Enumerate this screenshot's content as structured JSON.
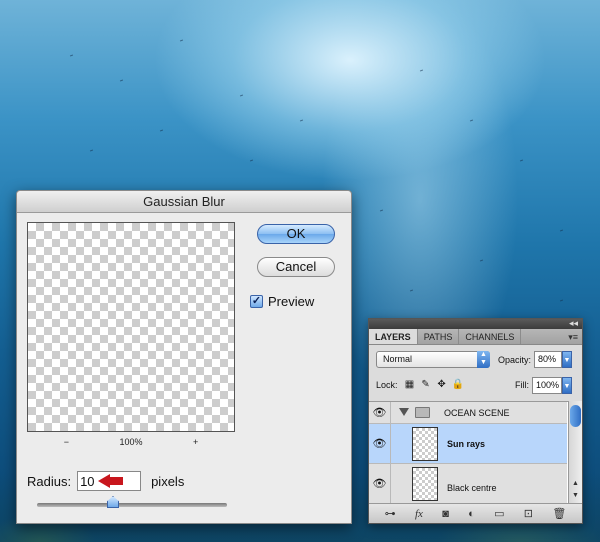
{
  "gaussian_blur": {
    "title": "Gaussian Blur",
    "ok_label": "OK",
    "cancel_label": "Cancel",
    "preview_label": "Preview",
    "preview_checked": "✓",
    "zoom_out": "−",
    "zoom_level": "100%",
    "zoom_in": "+",
    "radius_label": "Radius:",
    "radius_value": "10",
    "radius_unit": "pixels",
    "radius_slider_level": 0.4
  },
  "layers_panel": {
    "collapse_glyph": "◂◂",
    "menu_glyph": "▾≡",
    "tabs": [
      "LAYERS",
      "PATHS",
      "CHANNELS"
    ],
    "blend_mode": "Normal",
    "opacity_label": "Opacity:",
    "opacity_value": "80%",
    "lock_label": "Lock:",
    "lock_icons": [
      "▦",
      "✎",
      "✥",
      "🔒"
    ],
    "fill_label": "Fill:",
    "fill_value": "100%",
    "eye_glyph": "👁",
    "layers": [
      {
        "name": "OCEAN SCENE",
        "type": "group"
      },
      {
        "name": "Sun rays",
        "type": "layer",
        "selected": true
      },
      {
        "name": "Black centre",
        "type": "layer"
      }
    ],
    "bottom_icons": [
      "⊶",
      "fx",
      "◙",
      "◐",
      "▭",
      "⊡",
      "🗑"
    ]
  },
  "colors": {
    "selection": "#b8d6fb",
    "arrow": "#c8161d",
    "accent": "#3a63a8"
  }
}
